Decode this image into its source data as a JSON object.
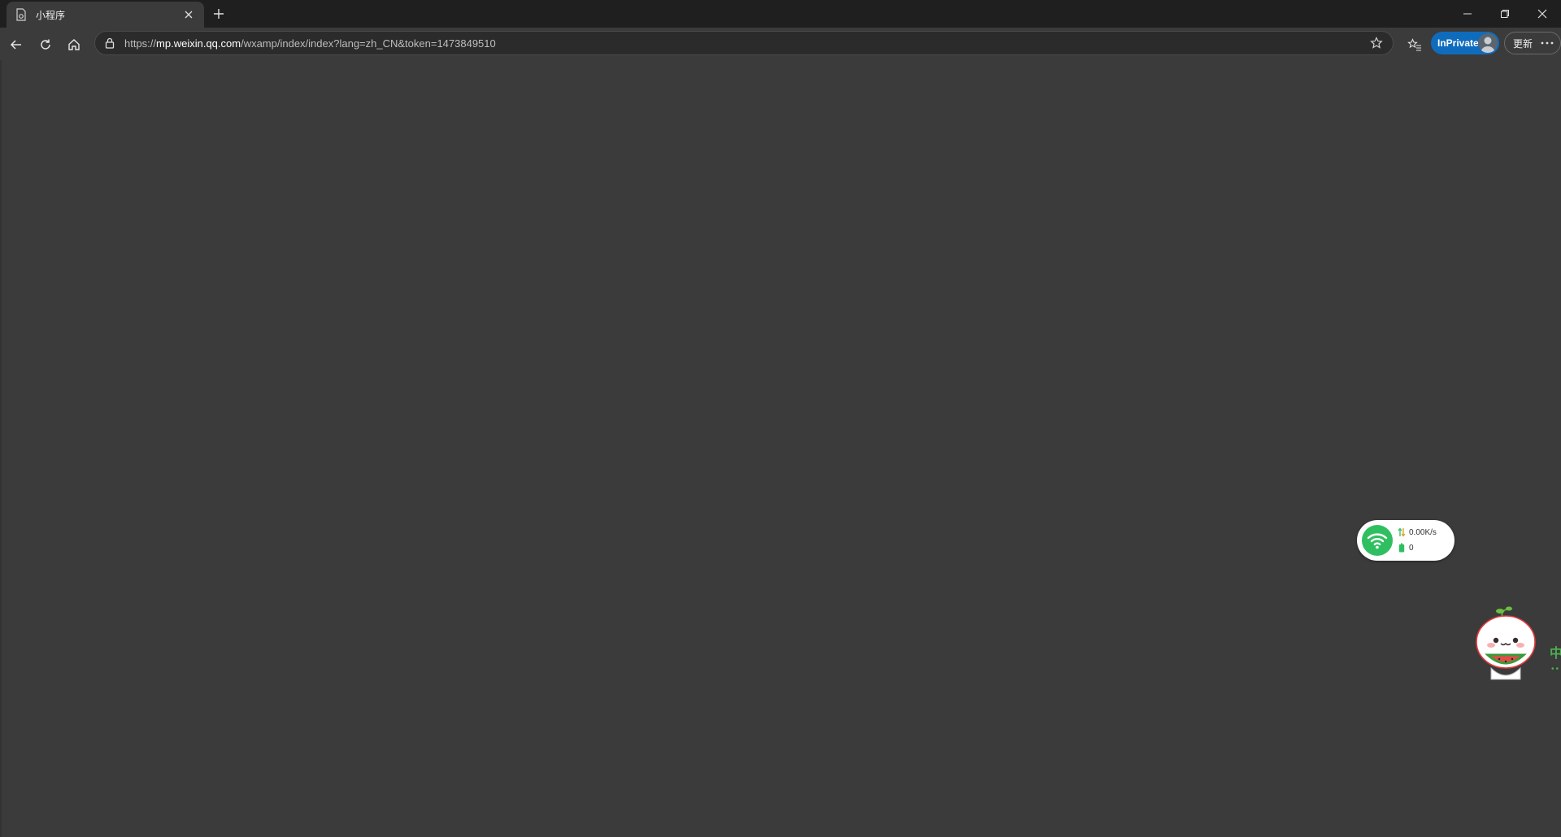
{
  "browser": {
    "tab": {
      "title": "小程序"
    },
    "address": {
      "scheme": "https://",
      "host": "mp.weixin.qq.com",
      "path": "/wxamp/index/index?lang=zh_CN&token=1473849510"
    },
    "inprivate_label": "InPrivate",
    "update_label": "更新",
    "colors": {
      "titlebar": "#1f1f1f",
      "toolbar": "#3b3b3b",
      "inprivate": "#0f6cbd"
    }
  },
  "page": {
    "background": "#3b3b3b"
  },
  "network_widget": {
    "speed": "0.00K/s",
    "count": "0",
    "accent": "#2fbf60"
  },
  "side_label": {
    "char": "中",
    "dots": "••"
  }
}
